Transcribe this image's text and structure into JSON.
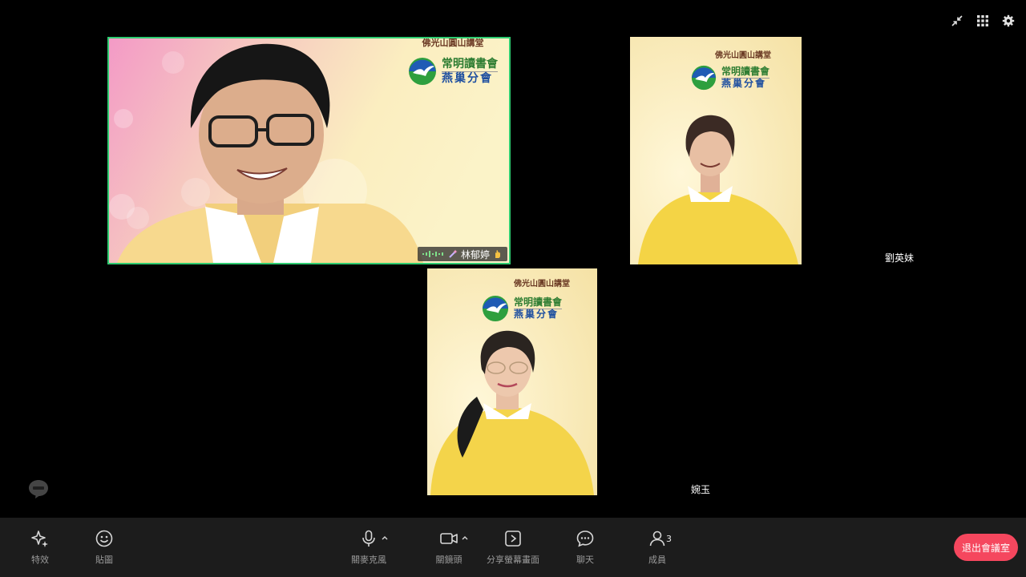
{
  "participants": {
    "main": {
      "name": "林郁婷"
    },
    "right": {
      "name": "劉英妹"
    },
    "bottom": {
      "name": "婉玉"
    }
  },
  "background_logo": {
    "temple_name": "佛光山圓山講堂",
    "reading_club": "常明讀書會",
    "branch": "燕巢分會"
  },
  "top_controls": {
    "icons": [
      "collapse-icon",
      "grid-view-icon",
      "settings-icon"
    ]
  },
  "toolbar": {
    "effects": "特效",
    "stickers": "貼圖",
    "mic": "關麥克風",
    "camera": "關鏡頭",
    "share_screen": "分享螢幕畫面",
    "chat": "聊天",
    "members": "成員",
    "member_count": "3",
    "leave": "退出會議室"
  },
  "colors": {
    "background": "#000000",
    "toolbar": "#1c1c1c",
    "active_speaker_border": "#2ecc71",
    "leave_button": "#f5475e",
    "logo_green": "#2e7d32",
    "logo_blue": "#1e4fa0"
  }
}
